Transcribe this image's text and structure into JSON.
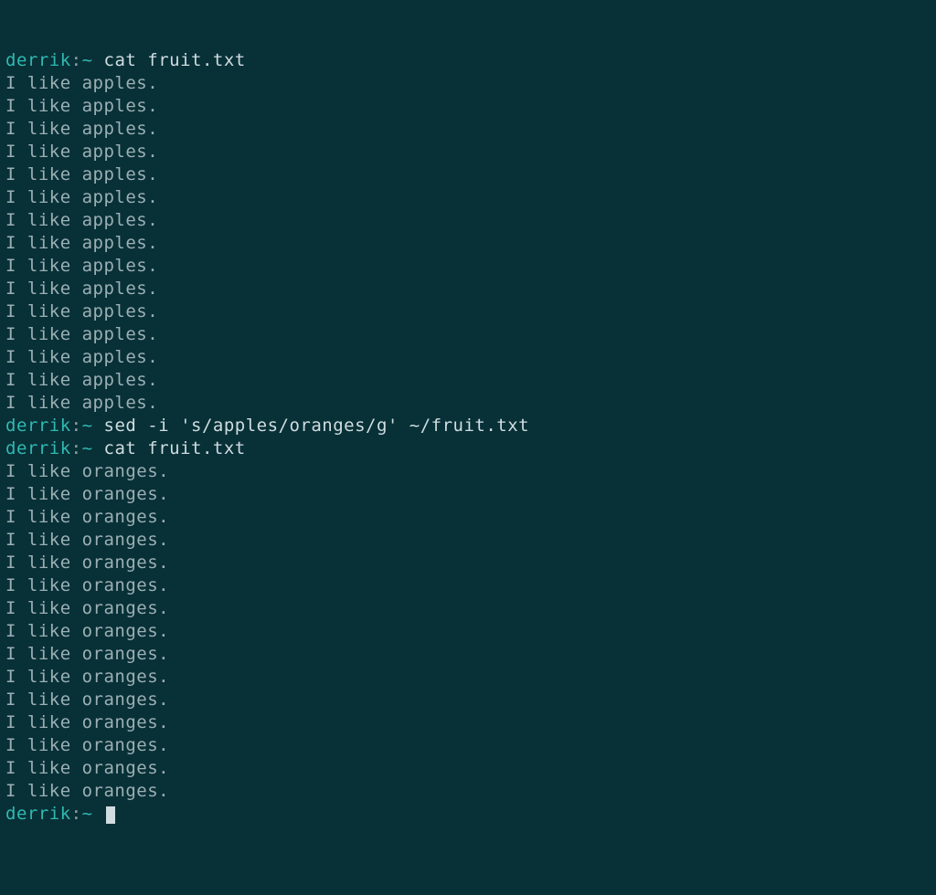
{
  "prompt": {
    "user": "derrik",
    "sep": ":",
    "path": "~"
  },
  "blocks": [
    {
      "type": "cmd",
      "command": "cat fruit.txt"
    },
    {
      "type": "out_repeat",
      "text": "I like apples.",
      "count": 15
    },
    {
      "type": "cmd",
      "command": "sed -i 's/apples/oranges/g' ~/fruit.txt"
    },
    {
      "type": "cmd",
      "command": "cat fruit.txt"
    },
    {
      "type": "out_repeat",
      "text": "I like oranges.",
      "count": 15
    },
    {
      "type": "cursor"
    }
  ]
}
